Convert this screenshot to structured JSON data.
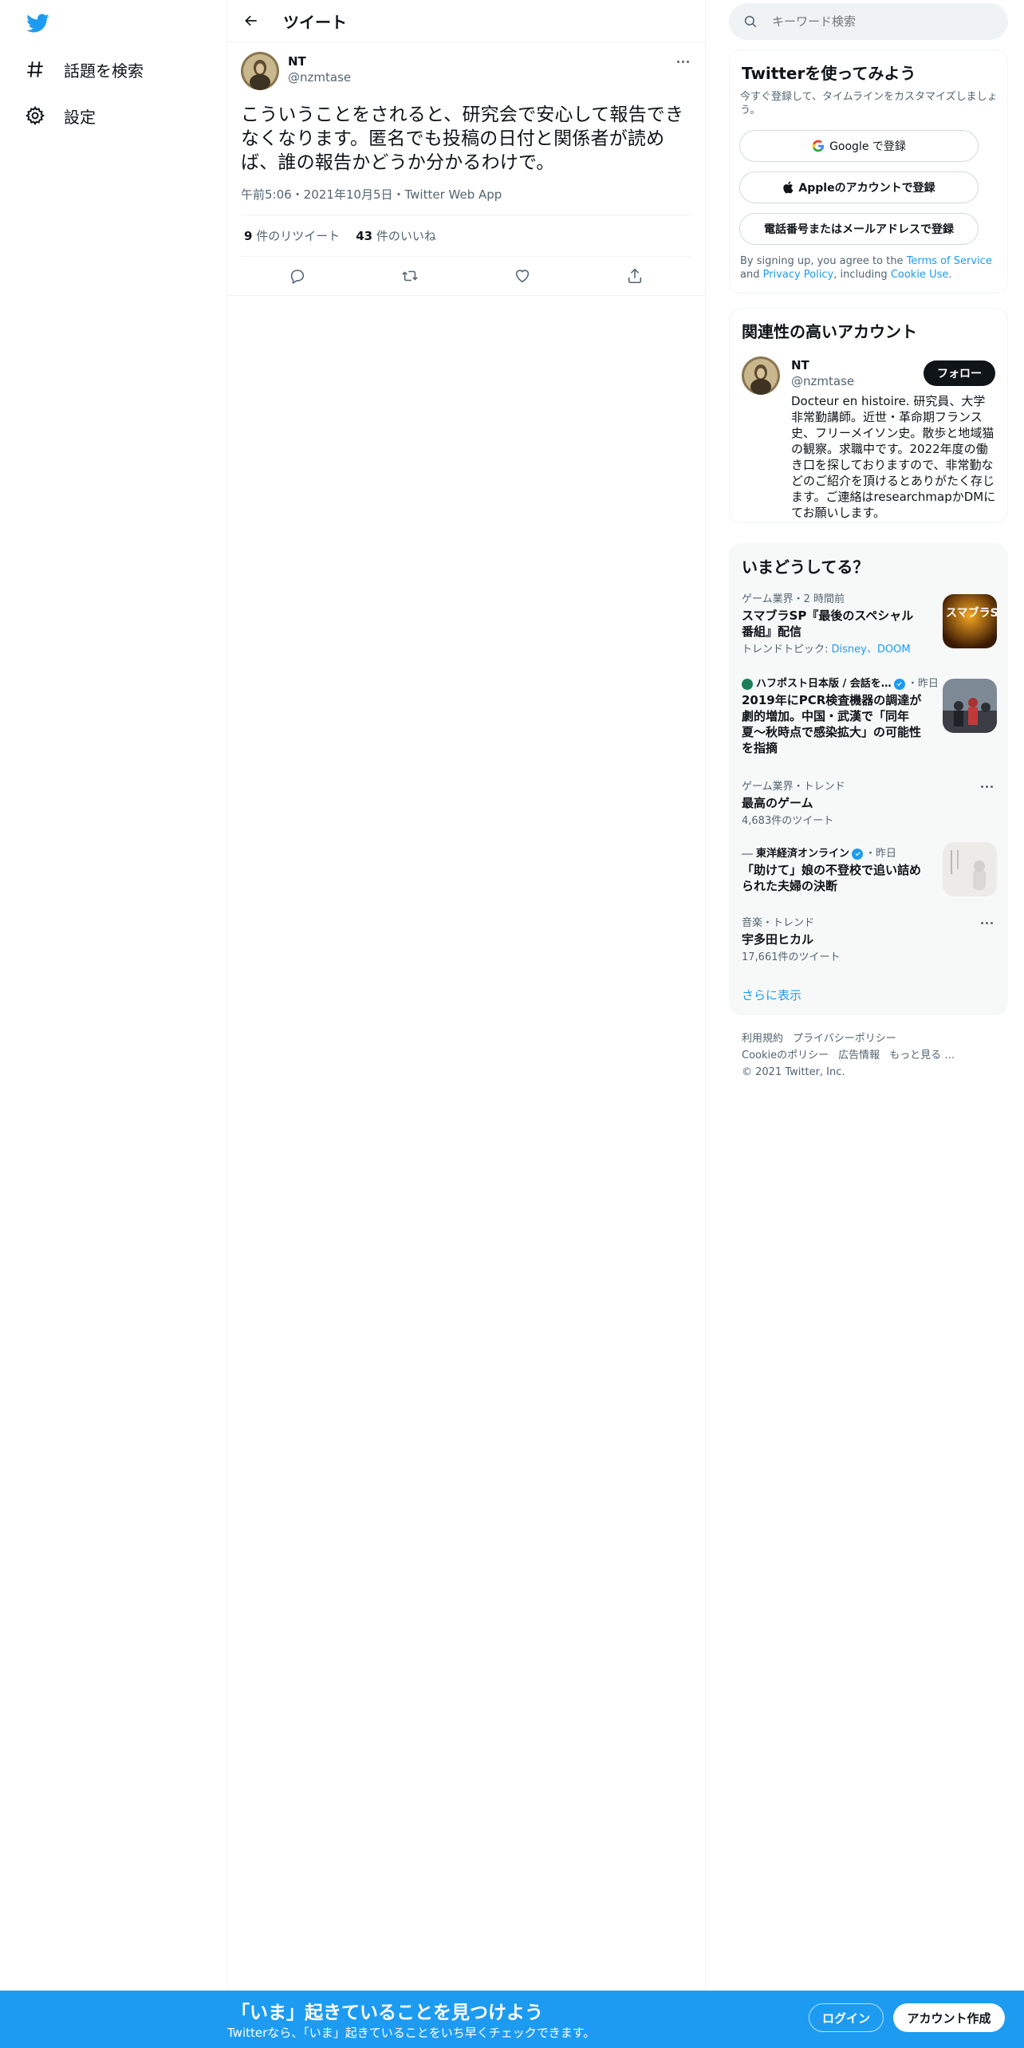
{
  "nav": {
    "explore_label": "話題を検索",
    "settings_label": "設定"
  },
  "header": {
    "title": "ツイート"
  },
  "tweet": {
    "author_name": "NT",
    "author_handle": "@nzmtase",
    "text": "こういうことをされると、研究会で安心して報告できなくなります。匿名でも投稿の日付と関係者が読めば、誰の報告かどうか分かるわけで。",
    "meta": "午前5:06・2021年10月5日・Twitter Web App",
    "retweet_count": "9",
    "retweet_label": " 件のリツイート",
    "like_count": "43",
    "like_label": " 件のいいね"
  },
  "search": {
    "placeholder": "キーワード検索"
  },
  "signup": {
    "title": "Twitterを使ってみよう",
    "subtitle": "今すぐ登録して、タイムラインをカスタマイズしましょう。",
    "google_label": "Google で登録",
    "apple_label": "Appleのアカウントで登録",
    "phone_label": "電話番号またはメールアドレスで登録",
    "terms_prefix": "By signing up, you agree to the ",
    "terms_link": "Terms of Service",
    "terms_and": " and ",
    "privacy_link": "Privacy Policy",
    "terms_including": ", including ",
    "cookie_link": "Cookie Use",
    "terms_end": "."
  },
  "related": {
    "title": "関連性の高いアカウント",
    "name": "NT",
    "handle": "@nzmtase",
    "follow_label": "フォロー",
    "bio": "Docteur en histoire. 研究員、大学非常勤講師。近世・革命期フランス史、フリーメイソン史。散歩と地域猫の観察。求職中です。2022年度の働き口を探しておりますので、非常勤などのご紹介を頂けるとありがたく存じます。ご連絡はresearchmapかDMにてお願いします。"
  },
  "trends": {
    "title": "いまどうしてる？",
    "items": [
      {
        "meta": "ゲーム業界・2 時間前",
        "name": "スマブラSP『最後のスペシャル番組』配信",
        "sub_prefix": "トレンドトピック: ",
        "sub_links": "Disney、DOOM",
        "thumb_text": "スマブラSP"
      },
      {
        "source": "ハフポスト日本版 / 会話を…",
        "time": "・昨日",
        "name": "2019年にPCR検査機器の調達が劇的増加。中国・武漢で「同年夏〜秋時点で感染拡大」の可能性を指摘"
      },
      {
        "meta": "ゲーム業界・トレンド",
        "name": "最高のゲーム",
        "sub": "4,683件のツイート"
      },
      {
        "source": "東洋経済オンライン",
        "time": "・昨日",
        "name": "「助けて」娘の不登校で追い詰められた夫婦の決断"
      },
      {
        "meta": "音楽・トレンド",
        "name": "宇多田ヒカル",
        "sub": "17,661件のツイート"
      }
    ],
    "show_more": "さらに表示"
  },
  "footer": {
    "terms": "利用規約",
    "privacy": "プライバシーポリシー",
    "cookie": "Cookieのポリシー",
    "ads": "広告情報",
    "more": "もっと見る …",
    "copyright": "© 2021 Twitter, Inc."
  },
  "bottom_bar": {
    "title": "「いま」起きていることを見つけよう",
    "subtitle": "Twitterなら、「いま」起きていることをいち早くチェックできます。",
    "login_label": "ログイン",
    "signup_label": "アカウント作成"
  },
  "colors": {
    "accent": "#1d9bf0",
    "text_primary": "#0f1419",
    "text_secondary": "#536471"
  }
}
